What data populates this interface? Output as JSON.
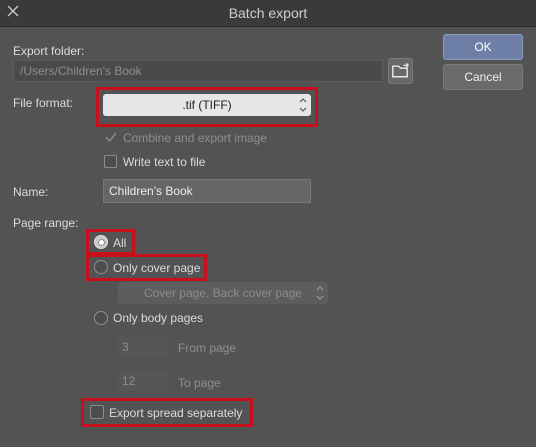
{
  "window": {
    "title": "Batch export"
  },
  "buttons": {
    "ok": "OK",
    "cancel": "Cancel"
  },
  "export_folder": {
    "label": "Export folder:",
    "path": "/Users/Children's Book"
  },
  "file_format": {
    "label": "File format:",
    "value": ".tif (TIFF)"
  },
  "combine": {
    "label": "Combine and export image",
    "checked": true,
    "enabled": false
  },
  "write_text": {
    "label": "Write text to file",
    "checked": false
  },
  "name": {
    "label": "Name:",
    "value": "Children's Book"
  },
  "page_range": {
    "label": "Page range:",
    "options": {
      "all": "All",
      "cover": "Only cover page",
      "body": "Only body pages"
    },
    "selected": "All",
    "cover_select": "Cover page, Back cover page",
    "from_value": "3",
    "from_label": "From page",
    "to_value": "12",
    "to_label": "To page"
  },
  "export_spread": {
    "label": "Export spread separately",
    "checked": false
  },
  "colors": {
    "highlight": "#c8101c",
    "ok_button": "#6d7fa6"
  }
}
